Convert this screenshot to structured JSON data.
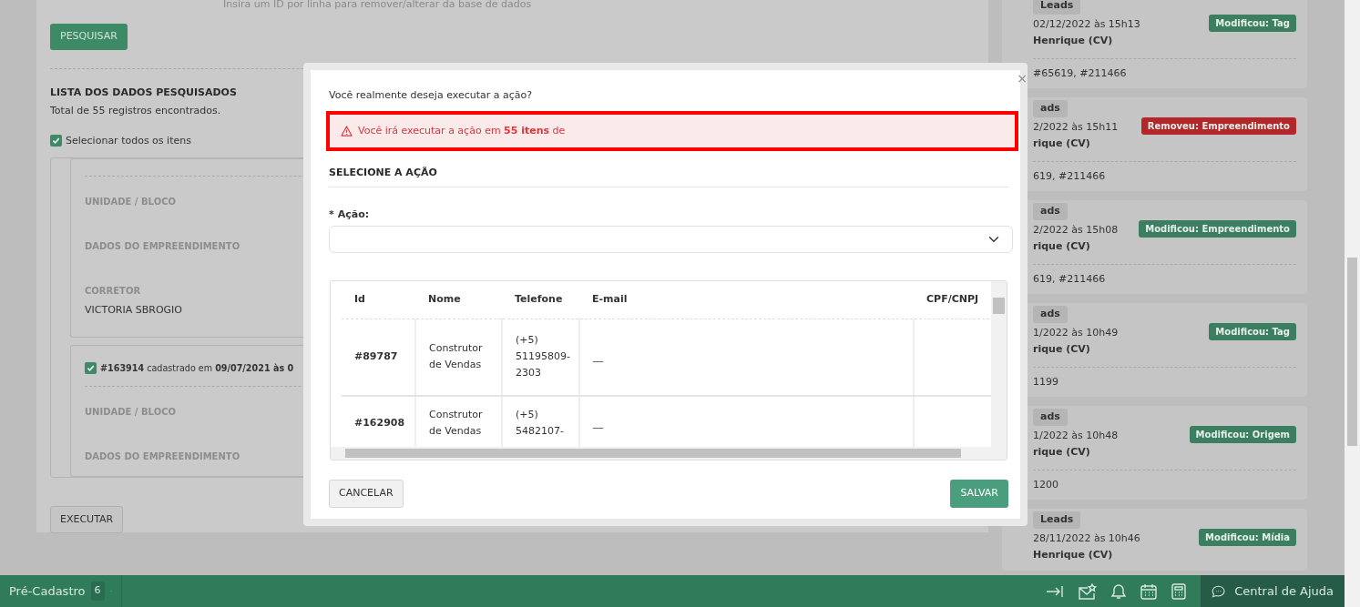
{
  "search_form": {
    "hint": "Insira um ID por linha para remover/alterar da base de dados",
    "search_button": "PESQUISAR"
  },
  "results": {
    "title": "LISTA DOS DADOS PESQUISADOS",
    "total": "Total de 55 registros encontrados.",
    "select_all": {
      "label": "Selecionar todos os itens",
      "checked": true
    },
    "items": [
      {
        "fields": [
          {
            "label": "UNIDADE / BLOCO"
          },
          {
            "label": "DADOS DO EMPREENDIMENTO"
          },
          {
            "label": "CORRETOR",
            "value": "VICTORIA SBROGIO"
          }
        ]
      },
      {
        "header": "**#163914** cadastrado em **09/07/2021 às 0**",
        "checked": true,
        "fields": [
          {
            "label": "UNIDADE / BLOCO"
          },
          {
            "label": "DADOS DO EMPREENDIMENTO"
          }
        ]
      }
    ],
    "execute_button": "EXECUTAR"
  },
  "history": [
    {
      "tag": "Leads",
      "date": "02/12/2022 às 15h13",
      "author": "Henrique (CV)",
      "change": "Modificou: Tag",
      "color": "#3b7f60",
      "ids": "#65619, #211466"
    },
    {
      "tag": "ads",
      "date": "2/2022 às 15h11",
      "author": "rique (CV)",
      "change": "Removeu: Empreendimento",
      "color": "#b3262a",
      "ids": "619, #211466"
    },
    {
      "tag": "ads",
      "date": "2/2022 às 15h08",
      "author": "rique (CV)",
      "change": "Modificou: Empreendimento",
      "color": "#3b7f60",
      "ids": "619, #211466"
    },
    {
      "tag": "ads",
      "date": "1/2022 às 10h49",
      "author": "rique (CV)",
      "change": "Modificou: Tag",
      "color": "#3b7f60",
      "ids": "1199"
    },
    {
      "tag": "ads",
      "date": "1/2022 às 10h48",
      "author": "rique (CV)",
      "change": "Modificou: Origem",
      "color": "#3b7f60",
      "ids": "1200"
    },
    {
      "tag": "Leads",
      "date": "28/11/2022 às 10h46",
      "author": "Henrique (CV)",
      "change": "Modificou: Mídia",
      "color": "#3b7f60"
    }
  ],
  "modal": {
    "close": "×",
    "question": "Você realmente deseja executar a ação?",
    "warning": "Você irá executar a ação em **55 itens** de",
    "section_title": "SELECIONE A AÇÃO",
    "required_mark": "*",
    "action_label": "Ação:",
    "table": {
      "columns": [
        "Id",
        "Nome",
        "Telefone",
        "E-mail",
        "CPF/CNPJ"
      ],
      "rows": [
        [
          "#89787",
          "Construtor de Vendas",
          "(+5) 51195809-2303",
          "__",
          ""
        ],
        [
          "#162908",
          "Construtor de Vendas",
          "(+5) 5482107-",
          "__",
          ""
        ]
      ]
    },
    "cancel_button": "CANCELAR",
    "save_button": "SALVAR"
  },
  "bottom_bar": {
    "module": "Pré-Cadastro",
    "count": "6",
    "help": "Central de Ajuda"
  }
}
